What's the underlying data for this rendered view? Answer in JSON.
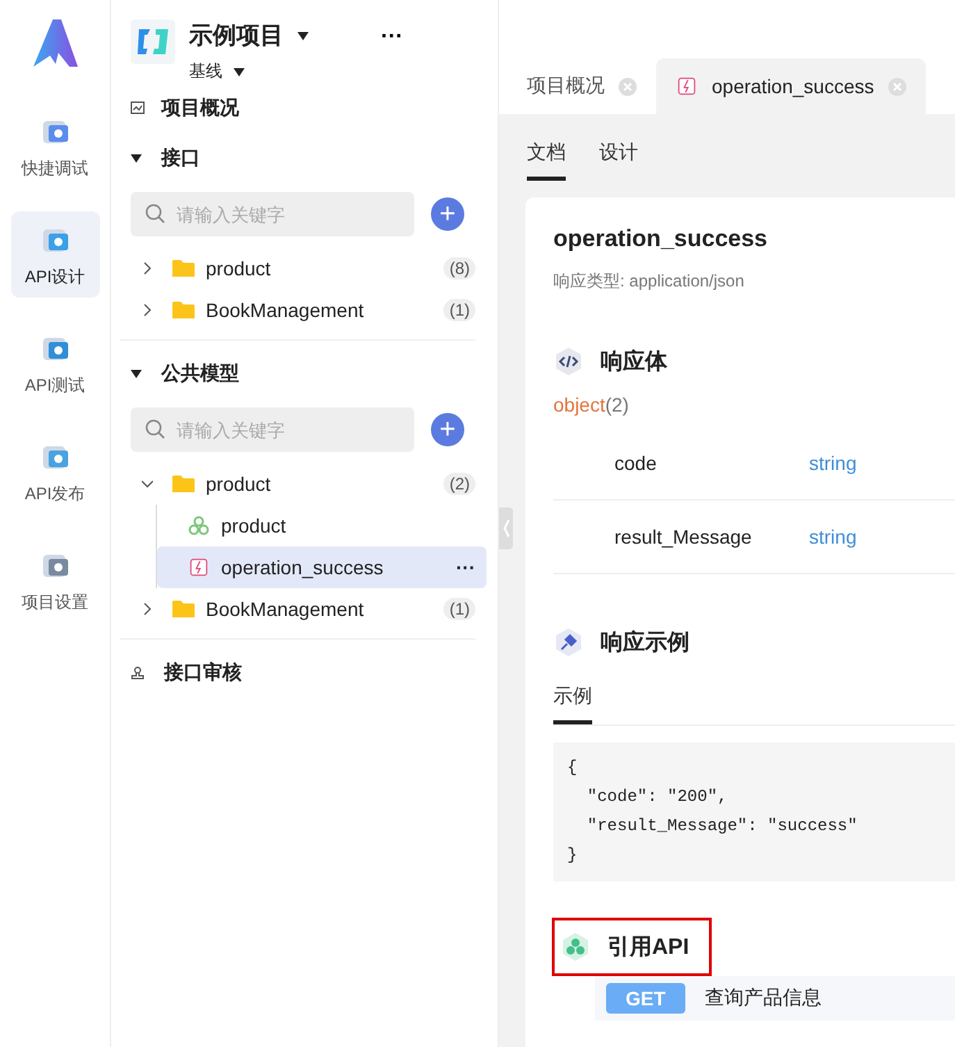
{
  "rail": [
    {
      "label": "快捷调试",
      "selected": false
    },
    {
      "label": "API设计",
      "selected": true
    },
    {
      "label": "API测试",
      "selected": false
    },
    {
      "label": "API发布",
      "selected": false
    },
    {
      "label": "项目设置",
      "selected": false
    }
  ],
  "project": {
    "name": "示例项目",
    "branch": "基线",
    "more": "···"
  },
  "overview": "项目概况",
  "sections": [
    {
      "title": "接口",
      "expanded": true,
      "placeholder": "请输入关键字",
      "add": "+",
      "tree": [
        {
          "name": "product",
          "kind": "folder",
          "count": "(8)",
          "expanded": false,
          "selected": false
        },
        {
          "name": "BookManagement",
          "kind": "folder",
          "count": "(1)",
          "expanded": false,
          "selected": false
        }
      ]
    },
    {
      "title": "公共模型",
      "expanded": true,
      "placeholder": "请输入关键字",
      "add": "+",
      "tree": [
        {
          "name": "product",
          "kind": "folder",
          "count": "(2)",
          "expanded": true,
          "selected": false,
          "children": [
            {
              "name": "product",
              "kind": "model",
              "selected": false
            },
            {
              "name": "operation_success",
              "kind": "response",
              "selected": true,
              "more": "···"
            }
          ]
        },
        {
          "name": "BookManagement",
          "kind": "folder",
          "count": "(1)",
          "expanded": false,
          "selected": false
        }
      ]
    }
  ],
  "review": "接口审核",
  "tabs": [
    {
      "label": "项目概况",
      "kind": "plain",
      "selected": false
    },
    {
      "label": "operation_success",
      "kind": "response",
      "selected": true
    }
  ],
  "subtabs": [
    {
      "label": "文档",
      "selected": true
    },
    {
      "label": "设计",
      "selected": false
    }
  ],
  "doc": {
    "title": "operation_success",
    "content_type": "响应类型: application/json",
    "body_title": "响应体",
    "root_type": "object",
    "root_count": "(2)",
    "fields": [
      {
        "name": "code",
        "type": "string"
      },
      {
        "name": "result_Message",
        "type": "string"
      }
    ],
    "example_title": "响应示例",
    "example_tabs": [
      {
        "label": "示例",
        "selected": true
      }
    ],
    "example_code": [
      "{",
      "  \"code\": \"200\",",
      "  \"result_Message\": \"success\"",
      "}"
    ],
    "ref_title": "引用API",
    "ref_highlighted": true,
    "refs": [
      {
        "method": "GET",
        "name": "查询产品信息"
      }
    ]
  }
}
